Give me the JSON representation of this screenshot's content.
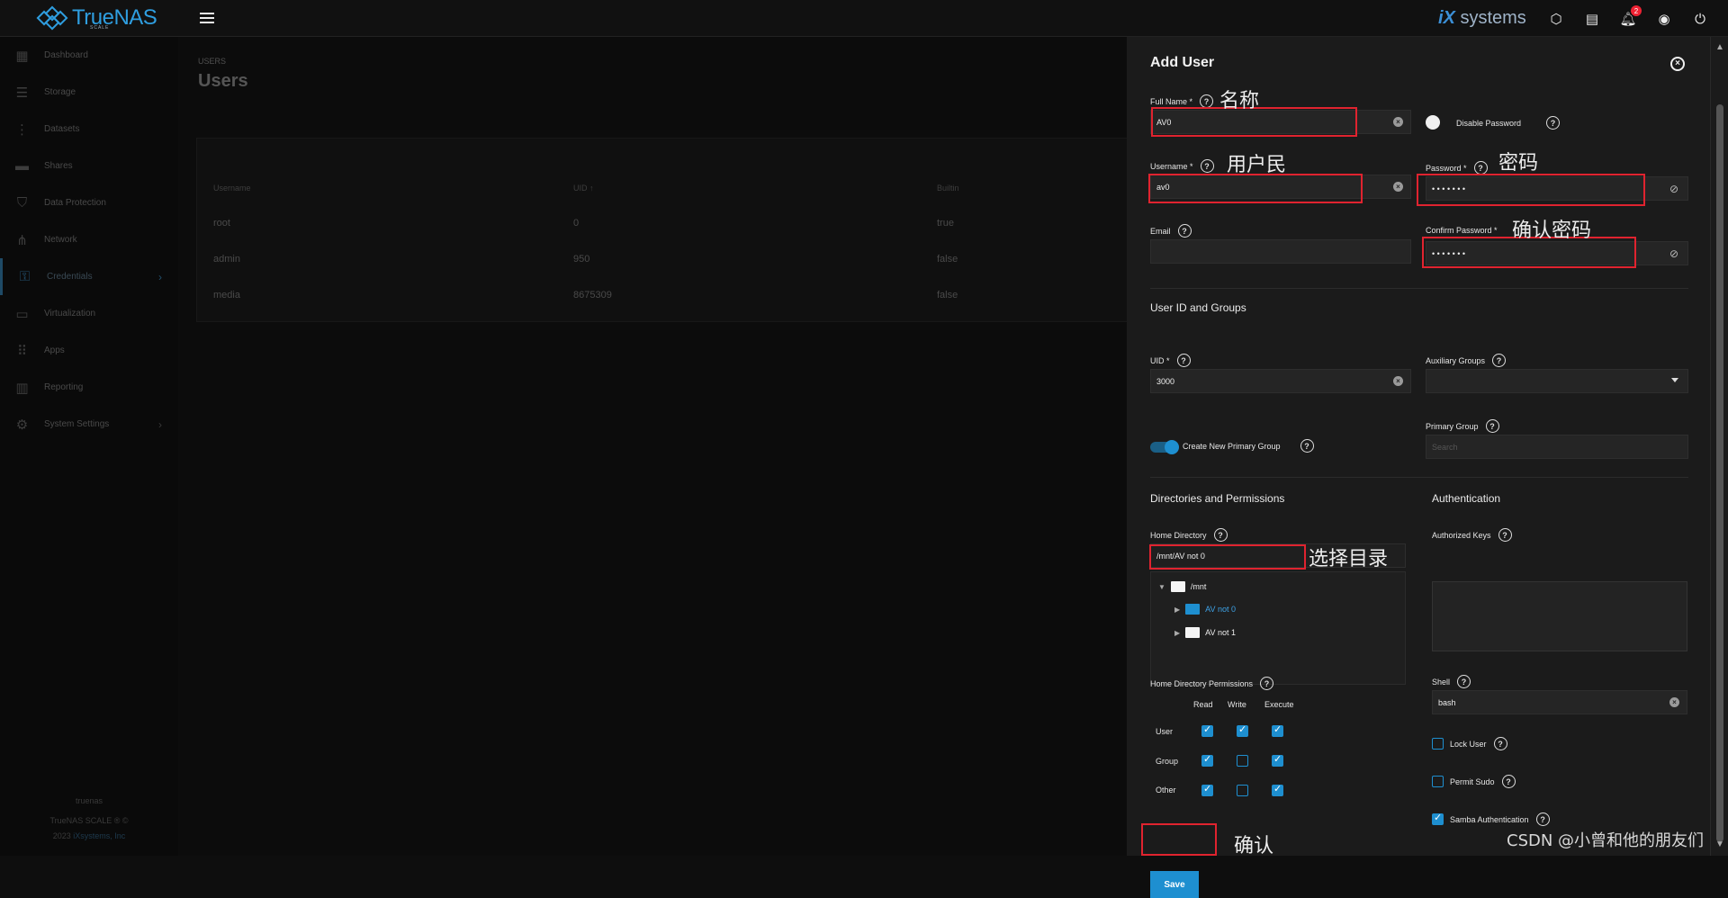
{
  "topbar": {
    "brand": "TrueNAS",
    "brand_sub": "SCALE",
    "vendor_prefix": "iX",
    "vendor_suffix": "systems",
    "notification_count": "2"
  },
  "sidebar": {
    "items": [
      {
        "label": "Dashboard",
        "icon": "dashboard-icon"
      },
      {
        "label": "Storage",
        "icon": "storage-icon"
      },
      {
        "label": "Datasets",
        "icon": "datasets-icon"
      },
      {
        "label": "Shares",
        "icon": "shares-icon"
      },
      {
        "label": "Data Protection",
        "icon": "shield-icon"
      },
      {
        "label": "Network",
        "icon": "network-icon"
      },
      {
        "label": "Credentials",
        "icon": "key-icon"
      },
      {
        "label": "Virtualization",
        "icon": "laptop-icon"
      },
      {
        "label": "Apps",
        "icon": "apps-grid-icon"
      },
      {
        "label": "Reporting",
        "icon": "chart-icon"
      },
      {
        "label": "System Settings",
        "icon": "gear-icon"
      }
    ],
    "footer_host": "truenas",
    "footer_copyright": "TrueNAS SCALE ® ©",
    "footer_year": "2023",
    "footer_company": "iXsystems, Inc"
  },
  "main": {
    "breadcrumb": "USERS",
    "title": "Users",
    "table": {
      "headers": [
        "Username",
        "UID ↑",
        "Builtin"
      ],
      "rows": [
        [
          "root",
          "0",
          "true"
        ],
        [
          "admin",
          "950",
          "false"
        ],
        [
          "media",
          "8675309",
          "false"
        ]
      ]
    }
  },
  "panel": {
    "title": "Add User",
    "full_name_label": "Full Name *",
    "full_name_value": "AV0",
    "disable_password_label": "Disable Password",
    "username_label": "Username *",
    "username_value": "av0",
    "password_label": "Password *",
    "password_value": "• • • • • • •",
    "email_label": "Email",
    "confirm_password_label": "Confirm Password *",
    "confirm_password_value": "• • • • • • •",
    "section_ids": "User ID and Groups",
    "uid_label": "UID *",
    "uid_value": "3000",
    "aux_groups_label": "Auxiliary Groups",
    "primary_group_label": "Primary Group",
    "primary_group_placeholder": "Search",
    "create_primary_label": "Create New Primary Group",
    "section_dirs": "Directories and Permissions",
    "section_auth": "Authentication",
    "home_dir_label": "Home Directory",
    "home_dir_value": "/mnt/AV not 0",
    "tree_root": "/mnt",
    "tree_child_1": "AV not 0",
    "tree_child_2": "AV not 1",
    "auth_keys_label": "Authorized Keys",
    "home_perm_label": "Home Directory Permissions",
    "perm_cols": [
      "Read",
      "Write",
      "Execute"
    ],
    "perm_rows": [
      "User",
      "Group",
      "Other"
    ],
    "shell_label": "Shell",
    "shell_value": "bash",
    "lock_user_label": "Lock User",
    "permit_sudo_label": "Permit Sudo",
    "samba_auth_label": "Samba Authentication",
    "save_label": "Save"
  },
  "annotations": {
    "name": "名称",
    "username": "用户民",
    "password": "密码",
    "confirm_password": "确认密码",
    "home_dir": "选择目录",
    "save": "确认"
  },
  "watermark": "CSDN @小曾和他的朋友们"
}
